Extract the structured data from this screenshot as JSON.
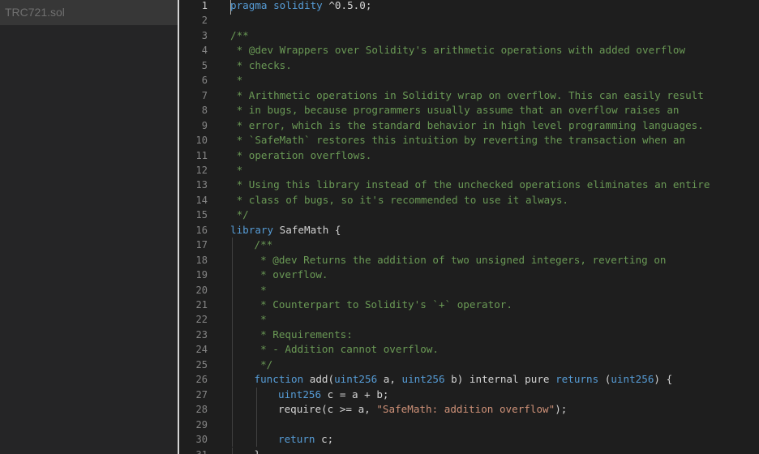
{
  "sidebar": {
    "file_name": "TRC721.sol"
  },
  "editor": {
    "active_line": 1,
    "lines": [
      {
        "n": "1",
        "indent": 0,
        "segs": [
          {
            "t": "pragma",
            "c": "k"
          },
          {
            "t": " ",
            "c": "p"
          },
          {
            "t": "solidity",
            "c": "k"
          },
          {
            "t": " ^0.5.0;",
            "c": "p"
          }
        ]
      },
      {
        "n": "2",
        "indent": 0,
        "segs": []
      },
      {
        "n": "3",
        "indent": 0,
        "segs": [
          {
            "t": "/**",
            "c": "c"
          }
        ]
      },
      {
        "n": "4",
        "indent": 0,
        "segs": [
          {
            "t": " * @dev Wrappers over Solidity's arithmetic operations with added overflow",
            "c": "c"
          }
        ]
      },
      {
        "n": "5",
        "indent": 0,
        "segs": [
          {
            "t": " * checks.",
            "c": "c"
          }
        ]
      },
      {
        "n": "6",
        "indent": 0,
        "segs": [
          {
            "t": " *",
            "c": "c"
          }
        ]
      },
      {
        "n": "7",
        "indent": 0,
        "segs": [
          {
            "t": " * Arithmetic operations in Solidity wrap on overflow. This can easily result",
            "c": "c"
          }
        ]
      },
      {
        "n": "8",
        "indent": 0,
        "segs": [
          {
            "t": " * in bugs, because programmers usually assume that an overflow raises an",
            "c": "c"
          }
        ]
      },
      {
        "n": "9",
        "indent": 0,
        "segs": [
          {
            "t": " * error, which is the standard behavior in high level programming languages.",
            "c": "c"
          }
        ]
      },
      {
        "n": "10",
        "indent": 0,
        "segs": [
          {
            "t": " * `SafeMath` restores this intuition by reverting the transaction when an",
            "c": "c"
          }
        ]
      },
      {
        "n": "11",
        "indent": 0,
        "segs": [
          {
            "t": " * operation overflows.",
            "c": "c"
          }
        ]
      },
      {
        "n": "12",
        "indent": 0,
        "segs": [
          {
            "t": " *",
            "c": "c"
          }
        ]
      },
      {
        "n": "13",
        "indent": 0,
        "segs": [
          {
            "t": " * Using this library instead of the unchecked operations eliminates an entire",
            "c": "c"
          }
        ]
      },
      {
        "n": "14",
        "indent": 0,
        "segs": [
          {
            "t": " * class of bugs, so it's recommended to use it always.",
            "c": "c"
          }
        ]
      },
      {
        "n": "15",
        "indent": 0,
        "segs": [
          {
            "t": " */",
            "c": "c"
          }
        ]
      },
      {
        "n": "16",
        "indent": 0,
        "segs": [
          {
            "t": "library",
            "c": "k"
          },
          {
            "t": " SafeMath {",
            "c": "p"
          }
        ]
      },
      {
        "n": "17",
        "indent": 1,
        "segs": [
          {
            "t": "/**",
            "c": "c"
          }
        ]
      },
      {
        "n": "18",
        "indent": 1,
        "segs": [
          {
            "t": " * @dev Returns the addition of two unsigned integers, reverting on",
            "c": "c"
          }
        ]
      },
      {
        "n": "19",
        "indent": 1,
        "segs": [
          {
            "t": " * overflow.",
            "c": "c"
          }
        ]
      },
      {
        "n": "20",
        "indent": 1,
        "segs": [
          {
            "t": " *",
            "c": "c"
          }
        ]
      },
      {
        "n": "21",
        "indent": 1,
        "segs": [
          {
            "t": " * Counterpart to Solidity's `+` operator.",
            "c": "c"
          }
        ]
      },
      {
        "n": "22",
        "indent": 1,
        "segs": [
          {
            "t": " *",
            "c": "c"
          }
        ]
      },
      {
        "n": "23",
        "indent": 1,
        "segs": [
          {
            "t": " * Requirements:",
            "c": "c"
          }
        ]
      },
      {
        "n": "24",
        "indent": 1,
        "segs": [
          {
            "t": " * - Addition cannot overflow.",
            "c": "c"
          }
        ]
      },
      {
        "n": "25",
        "indent": 1,
        "segs": [
          {
            "t": " */",
            "c": "c"
          }
        ]
      },
      {
        "n": "26",
        "indent": 1,
        "segs": [
          {
            "t": "function",
            "c": "k"
          },
          {
            "t": " add(",
            "c": "p"
          },
          {
            "t": "uint256",
            "c": "k"
          },
          {
            "t": " a, ",
            "c": "p"
          },
          {
            "t": "uint256",
            "c": "k"
          },
          {
            "t": " b) internal pure ",
            "c": "p"
          },
          {
            "t": "returns",
            "c": "k"
          },
          {
            "t": " (",
            "c": "p"
          },
          {
            "t": "uint256",
            "c": "k"
          },
          {
            "t": ") {",
            "c": "p"
          }
        ]
      },
      {
        "n": "27",
        "indent": 2,
        "segs": [
          {
            "t": "uint256",
            "c": "k"
          },
          {
            "t": " c = a + b;",
            "c": "p"
          }
        ]
      },
      {
        "n": "28",
        "indent": 2,
        "segs": [
          {
            "t": "require(c >= a, ",
            "c": "p"
          },
          {
            "t": "\"SafeMath: addition overflow\"",
            "c": "s"
          },
          {
            "t": ");",
            "c": "p"
          }
        ]
      },
      {
        "n": "29",
        "indent": 2,
        "segs": []
      },
      {
        "n": "30",
        "indent": 2,
        "segs": [
          {
            "t": "return",
            "c": "k"
          },
          {
            "t": " c;",
            "c": "p"
          }
        ]
      },
      {
        "n": "31",
        "indent": 1,
        "segs": [
          {
            "t": "}",
            "c": "p"
          }
        ]
      }
    ]
  }
}
